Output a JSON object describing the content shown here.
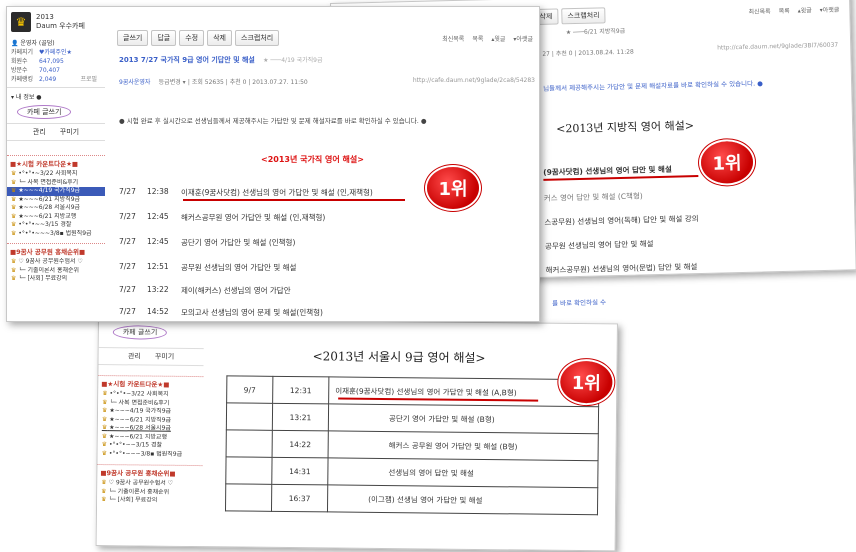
{
  "cafe": {
    "year": "2013",
    "name": "Daum 우수카페"
  },
  "toolbar": {
    "write": "글쓰기",
    "reply": "답글",
    "edit": "수정",
    "delete": "삭제",
    "scrap": "스크랩처리"
  },
  "toplinks": {
    "latest": "최신목록",
    "list": "목록",
    "prev": "▴윗글",
    "next": "▾아랫글"
  },
  "profile": {
    "manager_label": "운영자 (골덤)",
    "keeper_label": "카페지기",
    "keeper": "♥카페주인★",
    "members_label": "회원수",
    "members": "647,095",
    "visits_label": "방문수",
    "visits": "70,407",
    "ranking_label": "카페랭킹",
    "ranking": "2,049",
    "profile_link": "프로필",
    "myinfo": "▾ 내 정보 ●",
    "write_oval": "카페 글쓰기",
    "manage": "관리",
    "decorate": "꾸미기"
  },
  "sidebar_section1": "■★시험 카운트다운★■",
  "sidebar_items_a": [
    "•°•°•~3/22 사회복지",
    "└─ 사복 면접준비&후기",
    "★~~~4/19 국가직9급",
    "★~~~6/21 지방직9급",
    "★~~~6/28 서울시9급",
    "★~~~6/21 지방교행",
    "•°•°•~~3/15 경찰",
    "•°•°•~~~3/8▪ 법원직9급"
  ],
  "sidebar_items_b": [
    "•°•°•~3/22 사회복지",
    "└─ 사복 면접준비&후기",
    "★~~~4/19 국가직9급",
    "★~~~6/21 지방직9급",
    "★~~~6/28 서울시9급",
    "★~~~6/21 지방교행",
    "•°•°•~~3/15 경찰",
    "•°•°•~~~3/8▪ 법원직9급"
  ],
  "sidebar_section2": "■9꿈사 공무원 홍채순위■",
  "sidebar_items2": [
    "♡ 9꿈사 공무원수험서 ♡",
    "└─ 기출이론서 홍채순위",
    "└─ [사회] 무료강의"
  ],
  "post_a": {
    "title": "2013 7/27 국가직 9급 영어 기답안 및 해설",
    "sub": "★ ───4/19 국가직9급",
    "author": "9꿈사운영자",
    "grade": "등급변경 ▾",
    "meta": "| 조회 52635 | 추천 0 | 2013.07.27. 11:50",
    "url": "http://cafe.daum.net/9glade/2ca8/54283",
    "notice": "● 시험 완료 후 실시간으로 선생님들께서 제공해주시는 가답안 및 문제 해설자료를 바로 확인하실 수 있습니다. ●",
    "heading": "<2013년 국가직 영어 해설>",
    "rows": [
      {
        "date": "7/27",
        "time": "12:38",
        "text": "이재훈(9꿈사닷컴) 선생님의 영어 가답안 및 해설 (인,재책형)"
      },
      {
        "date": "7/27",
        "time": "12:45",
        "text": "해커스공무원 영어 가답안 및 해설 (인,재책형)"
      },
      {
        "date": "7/27",
        "time": "12:45",
        "text": "공단기 영어 가답안 및 해설 (인책형)"
      },
      {
        "date": "7/27",
        "time": "12:51",
        "text": "공무원 선생님의 영어 가답안 및 해설"
      },
      {
        "date": "7/27",
        "time": "13:22",
        "text": "제이(해커스) 선생님의 영어 가답안"
      },
      {
        "date": "7/27",
        "time": "14:52",
        "text": "모의고사 선생님의 영어 문제 및 해설(인책형)"
      }
    ]
  },
  "post_c": {
    "sub": "★ ───6/21 지방직9급",
    "meta": "27 | 추천 0 | 2013.08.24. 11:28",
    "url": "http://cafe.daum.net/9glade/3Bl7/60037",
    "notice": "님들께서 제공해주시는 가답안 및 문제 해설자료를 바로 확인하실 수 있습니다. ●",
    "heading": "<2013년 지방직 영어 해설>",
    "rows": [
      "(9꿈사닷컴) 선생님의 영어 답안 및 해설",
      "커스 영어 답안 및 해설 (C책형)",
      "스공무원) 선생님의 영어(독해) 답안 및 해설 강의",
      "공무원 선생님의 영어 답안 및 해설",
      "해커스공무원) 선생님의 영어(문법) 답안 및 해설",
      "공무원 선생님의 영어 답안 및 해설"
    ],
    "footer": "를 바로 확인하실 수"
  },
  "post_b": {
    "heading": "<2013년 서울시 9급 영어 해설>",
    "rows": [
      {
        "date": "9/7",
        "time": "12:31",
        "text": "이재훈(9꿈사닷컴) 선생님의 영어 가답안 및 해설 (A,B형)"
      },
      {
        "date": "",
        "time": "13:21",
        "text": "공단기 영어 가답안 및 해설 (B형)"
      },
      {
        "date": "",
        "time": "14:22",
        "text": "해커스 공무원 영어 가답안 및 해설 (B형)"
      },
      {
        "date": "",
        "time": "14:31",
        "text": "선생님의 영어 답안 및 해설"
      },
      {
        "date": "",
        "time": "16:37",
        "text": "(이그잼) 선생님 영어 가답안 및 해설"
      }
    ]
  },
  "badge": "1위",
  "colors": {
    "badge": "#c80000",
    "link": "#3a5fc8",
    "heading": "#d11111"
  }
}
